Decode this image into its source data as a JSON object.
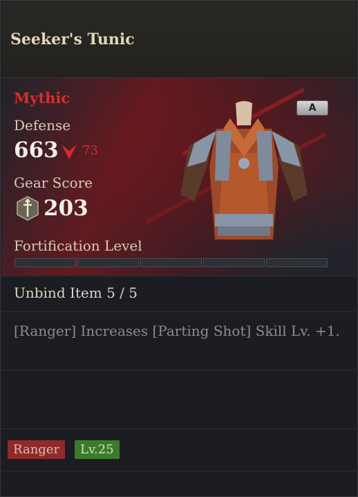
{
  "item": {
    "name": "Seeker's Tunic",
    "rarity": "Mythic",
    "grade_badge": "A",
    "defense_label": "Defense",
    "defense_value": "663",
    "defense_diff": "73",
    "gear_score_label": "Gear Score",
    "gear_score_value": "203",
    "fortification_label": "Fortification Level",
    "fortification_filled": 0,
    "fortification_slots": 5,
    "unbind_text": "Unbind Item 5 / 5",
    "effect_text": "[Ranger] Increases [Parting Shot] Skill Lv. +1.",
    "class_tag": "Ranger",
    "level_tag": "Lv.25"
  },
  "colors": {
    "rarity": "#d0302f",
    "diff_down": "#d52c2c",
    "class_tag": "#8e2a2a",
    "level_tag": "#3c7a2c"
  },
  "icons": {
    "down": "down-arrow-icon",
    "gear_score": "gear-score-icon"
  }
}
